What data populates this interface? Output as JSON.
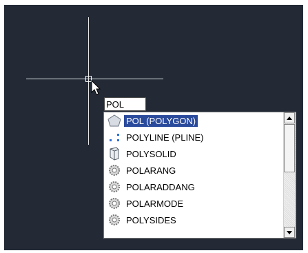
{
  "command_input": {
    "value": "POL"
  },
  "autocomplete": {
    "items": [
      {
        "label": "POL (POLYGON)",
        "icon": "polygon-icon",
        "selected": true
      },
      {
        "label": "POLYLINE (PLINE)",
        "icon": "polyline-icon",
        "selected": false
      },
      {
        "label": "POLYSOLID",
        "icon": "polysolid-icon",
        "selected": false
      },
      {
        "label": "POLARANG",
        "icon": "gear-icon",
        "selected": false
      },
      {
        "label": "POLARADDANG",
        "icon": "gear-icon",
        "selected": false
      },
      {
        "label": "POLARMODE",
        "icon": "gear-icon",
        "selected": false
      },
      {
        "label": "POLYSIDES",
        "icon": "gear-icon",
        "selected": false
      }
    ]
  },
  "colors": {
    "canvas_background": "#232a36",
    "selection_highlight": "#2a4a9c",
    "crosshair": "#e6e6e6"
  }
}
